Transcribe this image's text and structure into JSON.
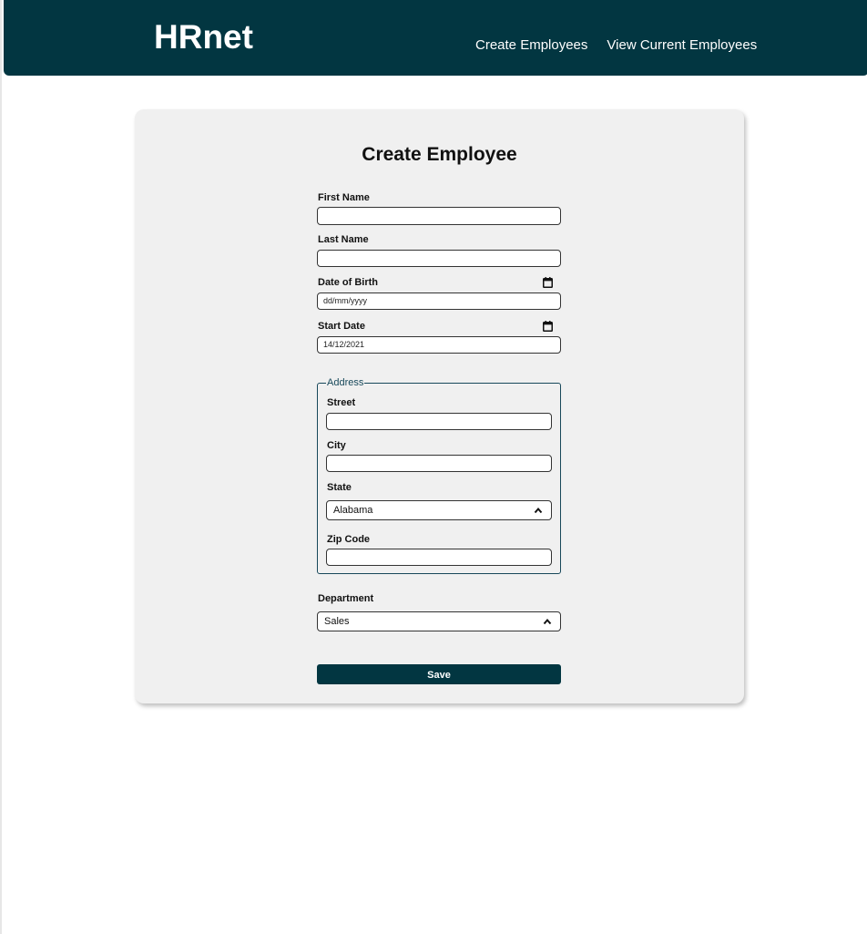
{
  "header": {
    "logo": "HRnet",
    "nav": [
      "Create Employees",
      "View Current Employees"
    ]
  },
  "form": {
    "title": "Create Employee",
    "first_name": {
      "label": "First Name",
      "value": ""
    },
    "last_name": {
      "label": "Last Name",
      "value": ""
    },
    "date_of_birth": {
      "label": "Date of Birth",
      "value": "dd/mm/yyyy",
      "icon": "calendar-icon"
    },
    "start_date": {
      "label": "Start Date",
      "value": "14/12/2021",
      "icon": "calendar-icon"
    },
    "address": {
      "legend": "Address",
      "street": {
        "label": "Street",
        "value": ""
      },
      "city": {
        "label": "City",
        "value": ""
      },
      "state": {
        "label": "State",
        "selected": "Alabama",
        "icon": "chevron-up-icon"
      },
      "zip": {
        "label": "Zip Code",
        "value": ""
      }
    },
    "department": {
      "label": "Department",
      "selected": "Sales",
      "icon": "chevron-up-icon"
    },
    "save_label": "Save"
  },
  "colors": {
    "primary": "#023641",
    "card": "#f0f0f0",
    "fieldset_border": "#17485a"
  }
}
